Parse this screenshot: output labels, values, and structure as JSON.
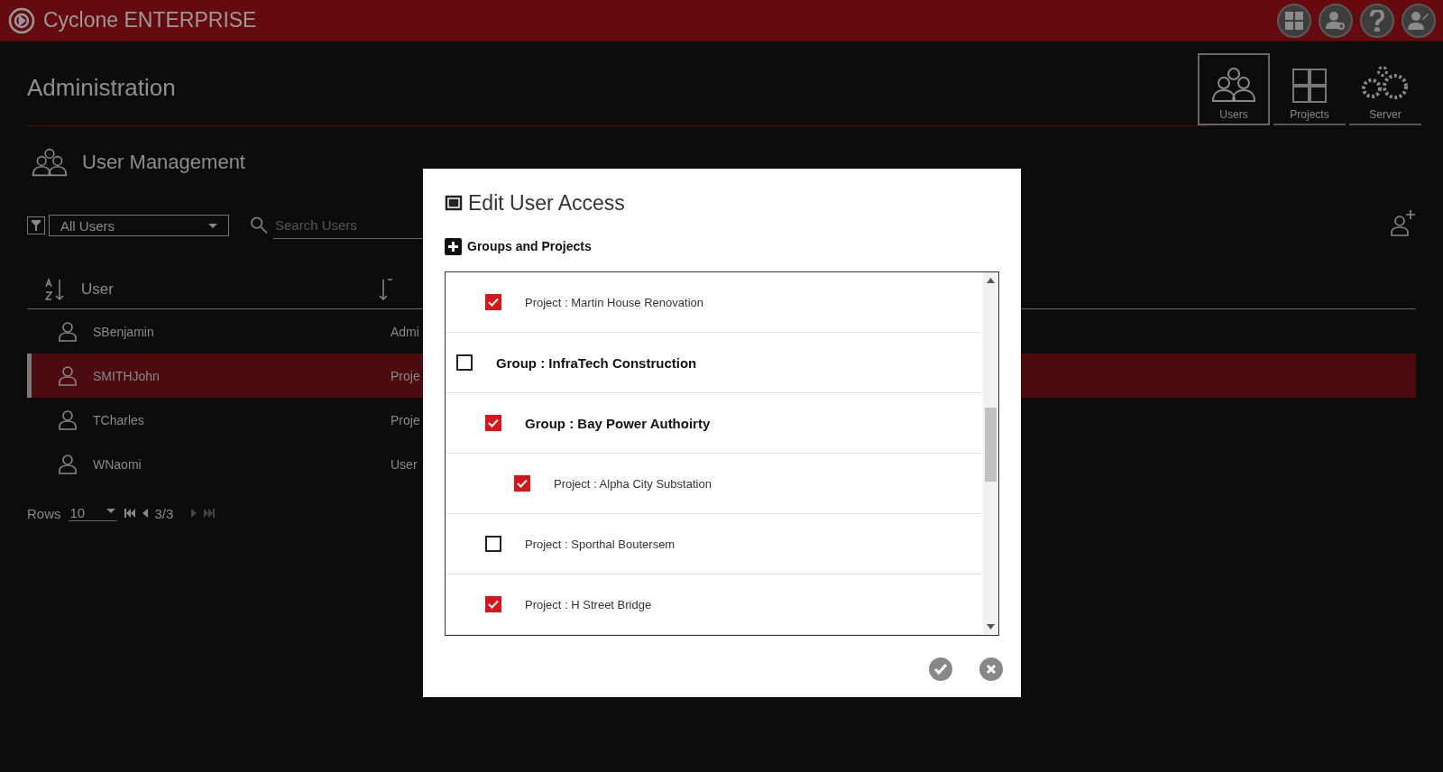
{
  "app": {
    "title": "Cyclone ENTERPRISE"
  },
  "page": {
    "title": "Administration"
  },
  "nav_tabs": [
    {
      "label": "Users",
      "kind": "users",
      "selected": true
    },
    {
      "label": "Projects",
      "kind": "projects",
      "selected": false
    },
    {
      "label": "Server",
      "kind": "server",
      "selected": false
    }
  ],
  "section": {
    "title": "User Management"
  },
  "filter": {
    "value": "All Users"
  },
  "search": {
    "placeholder": "Search Users"
  },
  "table": {
    "columns": [
      "User"
    ],
    "rows": [
      {
        "user": "SBenjamin",
        "column_2": "Admi",
        "selected": false
      },
      {
        "user": "SMITHJohn",
        "column_2": "Proje",
        "selected": true
      },
      {
        "user": "TCharles",
        "column_2": "Proje",
        "selected": false
      },
      {
        "user": "WNaomi",
        "column_2": "User",
        "selected": false
      }
    ]
  },
  "pagination": {
    "label": "Rows",
    "rows_per_page": "10",
    "page": "3/3"
  },
  "dialog": {
    "title": "Edit User Access",
    "section": "Groups and Projects",
    "tree": [
      {
        "kind": "continued",
        "children": [
          {
            "kind": "project",
            "label": "Project : Martin House Renovation",
            "checked": true
          }
        ]
      },
      {
        "kind": "group",
        "label": "Group : InfraTech Construction",
        "checked": false,
        "children": [
          {
            "kind": "group",
            "label": "Group : Bay Power Authoirty",
            "checked": true,
            "children": [
              {
                "kind": "project",
                "label": "Project : Alpha City Substation",
                "checked": true
              }
            ]
          },
          {
            "kind": "project",
            "label": "Project : Sporthal Boutersem",
            "checked": false
          },
          {
            "kind": "project",
            "label": "Project : H Street Bridge",
            "checked": true
          }
        ]
      }
    ]
  }
}
